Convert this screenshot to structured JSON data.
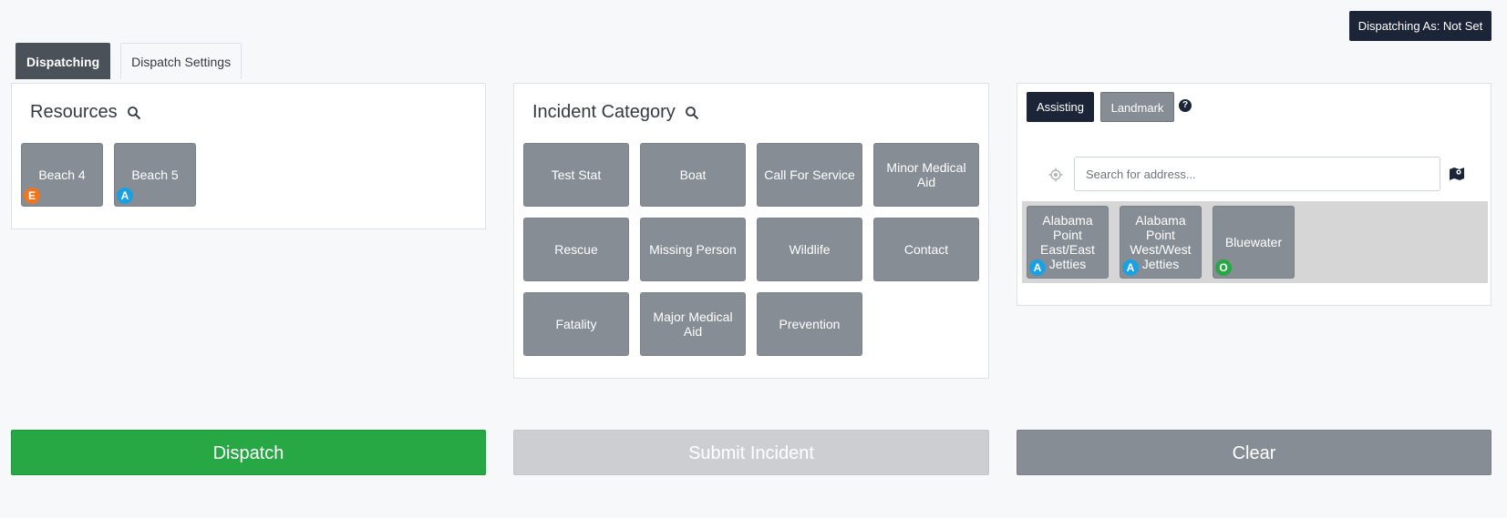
{
  "header": {
    "dispatching_as": "Dispatching As: Not Set"
  },
  "tabs": [
    {
      "label": "Dispatching",
      "active": true
    },
    {
      "label": "Dispatch Settings",
      "active": false
    }
  ],
  "resources": {
    "title": "Resources",
    "items": [
      {
        "label": "Beach 4",
        "badge": "E",
        "badge_color": "#f0761e"
      },
      {
        "label": "Beach 5",
        "badge": "A",
        "badge_color": "#1ba0e2"
      }
    ]
  },
  "incident_category": {
    "title": "Incident Category",
    "items": [
      {
        "label": "Test Stat"
      },
      {
        "label": "Boat"
      },
      {
        "label": "Call For Service"
      },
      {
        "label": "Minor Medical Aid"
      },
      {
        "label": "Rescue"
      },
      {
        "label": "Missing Person"
      },
      {
        "label": "Wildlife"
      },
      {
        "label": "Contact"
      },
      {
        "label": "Fatality"
      },
      {
        "label": "Major Medical Aid"
      },
      {
        "label": "Prevention"
      }
    ]
  },
  "location": {
    "assisting_label": "Assisting",
    "landmark_label": "Landmark",
    "help_glyph": "?",
    "search_placeholder": "Search for address...",
    "landmarks": [
      {
        "label": "Alabama Point East/East Jetties",
        "badge": "A",
        "badge_color": "#1ba0e2"
      },
      {
        "label": "Alabama Point West/West Jetties",
        "badge": "A",
        "badge_color": "#1ba0e2"
      },
      {
        "label": "Bluewater",
        "badge": "O",
        "badge_color": "#28a745"
      }
    ]
  },
  "actions": {
    "dispatch": "Dispatch",
    "submit_incident": "Submit Incident",
    "clear": "Clear"
  },
  "colors": {
    "dispatch": "#28a745",
    "submit_disabled": "#ccced2",
    "clear": "#878d95",
    "dark": "#1b2537"
  }
}
